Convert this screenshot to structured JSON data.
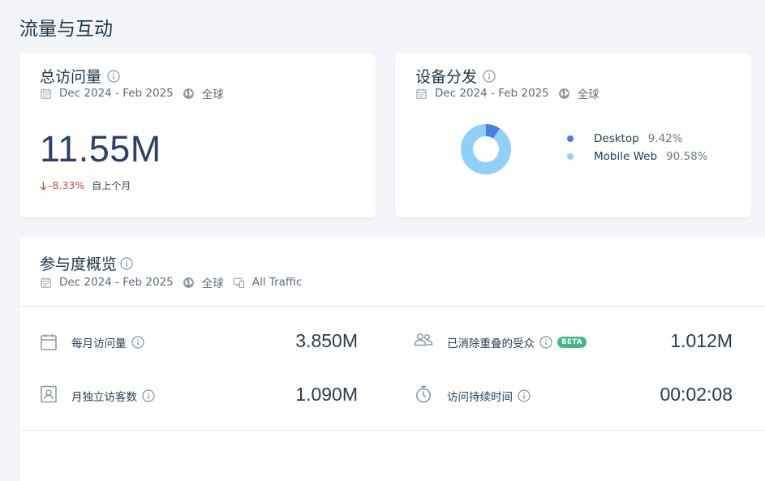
{
  "page": {
    "title": "流量与互动"
  },
  "visits_card": {
    "title": "总访问量",
    "date_range": "Dec 2024 - Feb 2025",
    "region": "全球",
    "value": "11.55M",
    "change": "-8.33%",
    "change_period": "自上个月"
  },
  "device_card": {
    "title": "设备分发",
    "date_range": "Dec 2024 - Feb 2025",
    "region": "全球",
    "legend": [
      {
        "name": "Desktop",
        "pct": "9.42%",
        "value": 9.42,
        "color": "#4b7be5"
      },
      {
        "name": "Mobile Web",
        "pct": "90.58%",
        "value": 90.58,
        "color": "#8fd0fa"
      }
    ]
  },
  "engagement_card": {
    "title": "参与度概览",
    "date_range": "Dec 2024 - Feb 2025",
    "region": "全球",
    "traffic": "All Traffic",
    "metrics": [
      {
        "label": "每月访问量",
        "value": "3.850M",
        "icon": "calendar-icon"
      },
      {
        "label": "已消除重叠的受众",
        "value": "1.012M",
        "icon": "people-icon",
        "badge": "BETA"
      },
      {
        "label": "月独立访客数",
        "value": "1.090M",
        "icon": "visitor-card-icon"
      },
      {
        "label": "访问持续时间",
        "value": "00:02:08",
        "icon": "stopwatch-icon"
      }
    ]
  }
}
